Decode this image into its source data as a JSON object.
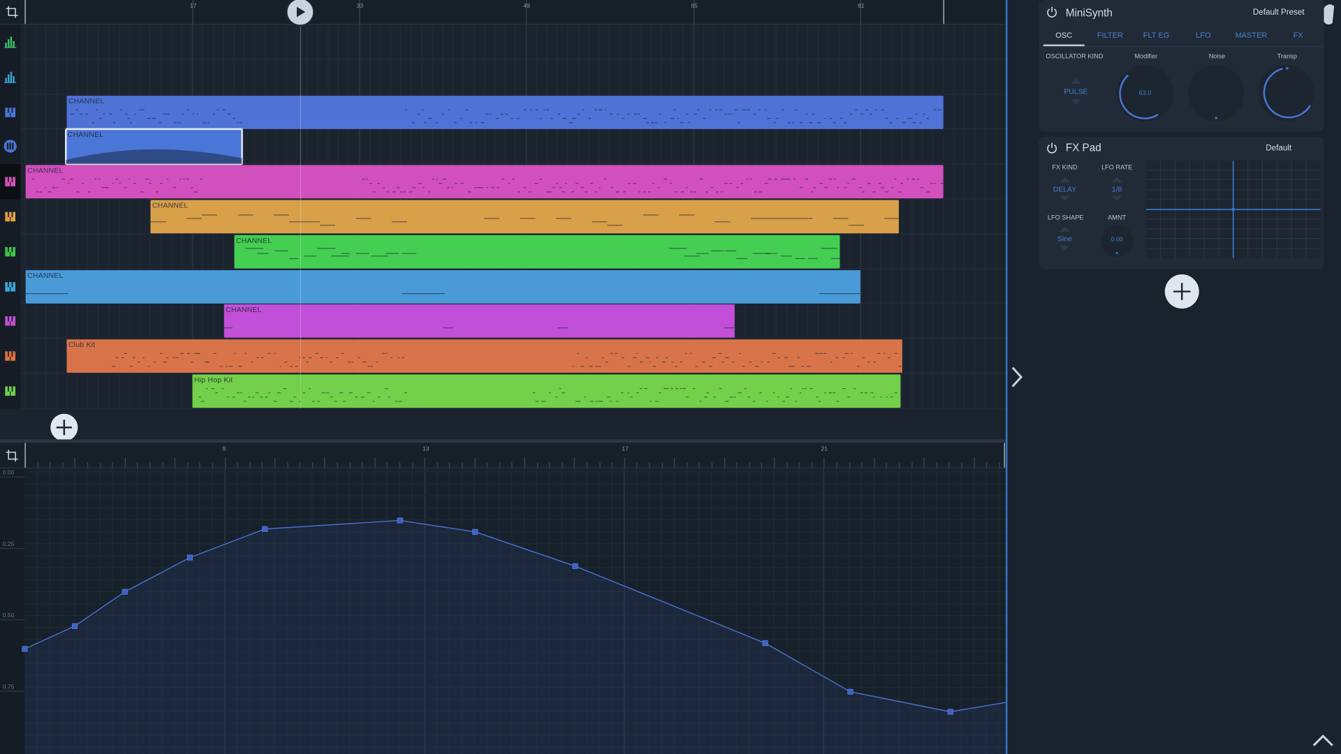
{
  "colors": {
    "accent": "#3a76c8",
    "background": "#1b232e",
    "panel": "#212b37",
    "automation_line": "#4a6fd0"
  },
  "playlist": {
    "ruler_numbers": [
      "17",
      "33",
      "49",
      "65",
      "81"
    ],
    "tracks": [
      {
        "icon": "bar-chart-icon",
        "icon_color": "#3fc16a",
        "clips": []
      },
      {
        "icon": "bar-chart-icon",
        "icon_color": "#3aa6d8",
        "clips": []
      },
      {
        "icon": "piano-icon",
        "icon_color": "#4a76d8",
        "clips": [
          {
            "label": "CHANNEL",
            "color": "#4f72d6",
            "pattern": "dots"
          }
        ]
      },
      {
        "icon": "automation-icon",
        "icon_color": "#4a76d8",
        "clips": [
          {
            "label": "CHANNEL",
            "color": "#4a76d8",
            "pattern": "curve",
            "selected": true
          }
        ]
      },
      {
        "icon": "piano-icon",
        "icon_color": "#d44fb8",
        "clips": [
          {
            "label": "CHANNEL",
            "color": "#d24fbe",
            "pattern": "dots"
          }
        ]
      },
      {
        "icon": "piano-icon",
        "icon_color": "#e0a040",
        "clips": [
          {
            "label": "CHANNEL",
            "color": "#d9a04a",
            "pattern": "chords"
          }
        ]
      },
      {
        "icon": "piano-icon",
        "icon_color": "#3fc44a",
        "clips": [
          {
            "label": "CHANNEL",
            "color": "#45cf52",
            "pattern": "melody"
          }
        ]
      },
      {
        "icon": "piano-icon",
        "icon_color": "#3aa6d8",
        "clips": [
          {
            "label": "CHANNEL",
            "color": "#4a9ad8",
            "pattern": "long"
          }
        ]
      },
      {
        "icon": "piano-icon",
        "icon_color": "#c34fd4",
        "clips": [
          {
            "label": "CHANNEL",
            "color": "#c24fd8",
            "pattern": "sparse"
          }
        ]
      },
      {
        "icon": "piano-icon",
        "icon_color": "#e07040",
        "clips": [
          {
            "label": "Club  Kit",
            "color": "#d9744a",
            "pattern": "drums"
          }
        ]
      },
      {
        "icon": "piano-icon",
        "icon_color": "#6ad04a",
        "clips": [
          {
            "label": "Hip  Hop  Kit",
            "color": "#72d04a",
            "pattern": "drums2"
          }
        ]
      }
    ]
  },
  "automation": {
    "ruler_numbers": [
      "9",
      "13",
      "17",
      "21"
    ],
    "y_labels": [
      "0.00",
      "0.25",
      "0.50",
      "0.75"
    ],
    "points": [
      {
        "beat": 5.0,
        "value": 0.62
      },
      {
        "beat": 6.0,
        "value": 0.54
      },
      {
        "beat": 7.0,
        "value": 0.42
      },
      {
        "beat": 8.3,
        "value": 0.3
      },
      {
        "beat": 9.8,
        "value": 0.2
      },
      {
        "beat": 12.5,
        "value": 0.17
      },
      {
        "beat": 14.0,
        "value": 0.21
      },
      {
        "beat": 16.0,
        "value": 0.33
      },
      {
        "beat": 19.8,
        "value": 0.6
      },
      {
        "beat": 21.5,
        "value": 0.77
      },
      {
        "beat": 23.5,
        "value": 0.84
      },
      {
        "beat": 25.2,
        "value": 0.79
      }
    ]
  },
  "minisynth": {
    "title": "MiniSynth",
    "preset": "Default  Preset",
    "tabs": [
      "OSC",
      "FILTER",
      "FLT EG",
      "LFO",
      "MASTER",
      "FX"
    ],
    "active_tab": "OSC",
    "oscillator_kind_label": "OSCILLATOR KIND",
    "oscillator_kind_value": "PULSE",
    "modifier_label": "Modifier",
    "modifier_value": "63.0",
    "noise_label": "Noise",
    "transp_label": "Transp"
  },
  "fxpad": {
    "title": "FX Pad",
    "preset": "Default",
    "fx_kind_label": "FX KIND",
    "fx_kind_value": "DELAY",
    "lfo_rate_label": "LFO RATE",
    "lfo_rate_value": "1/8",
    "lfo_shape_label": "LFO SHAPE",
    "lfo_shape_value": "Sine",
    "amnt_label": "AMNT",
    "amnt_value": "0.00"
  }
}
